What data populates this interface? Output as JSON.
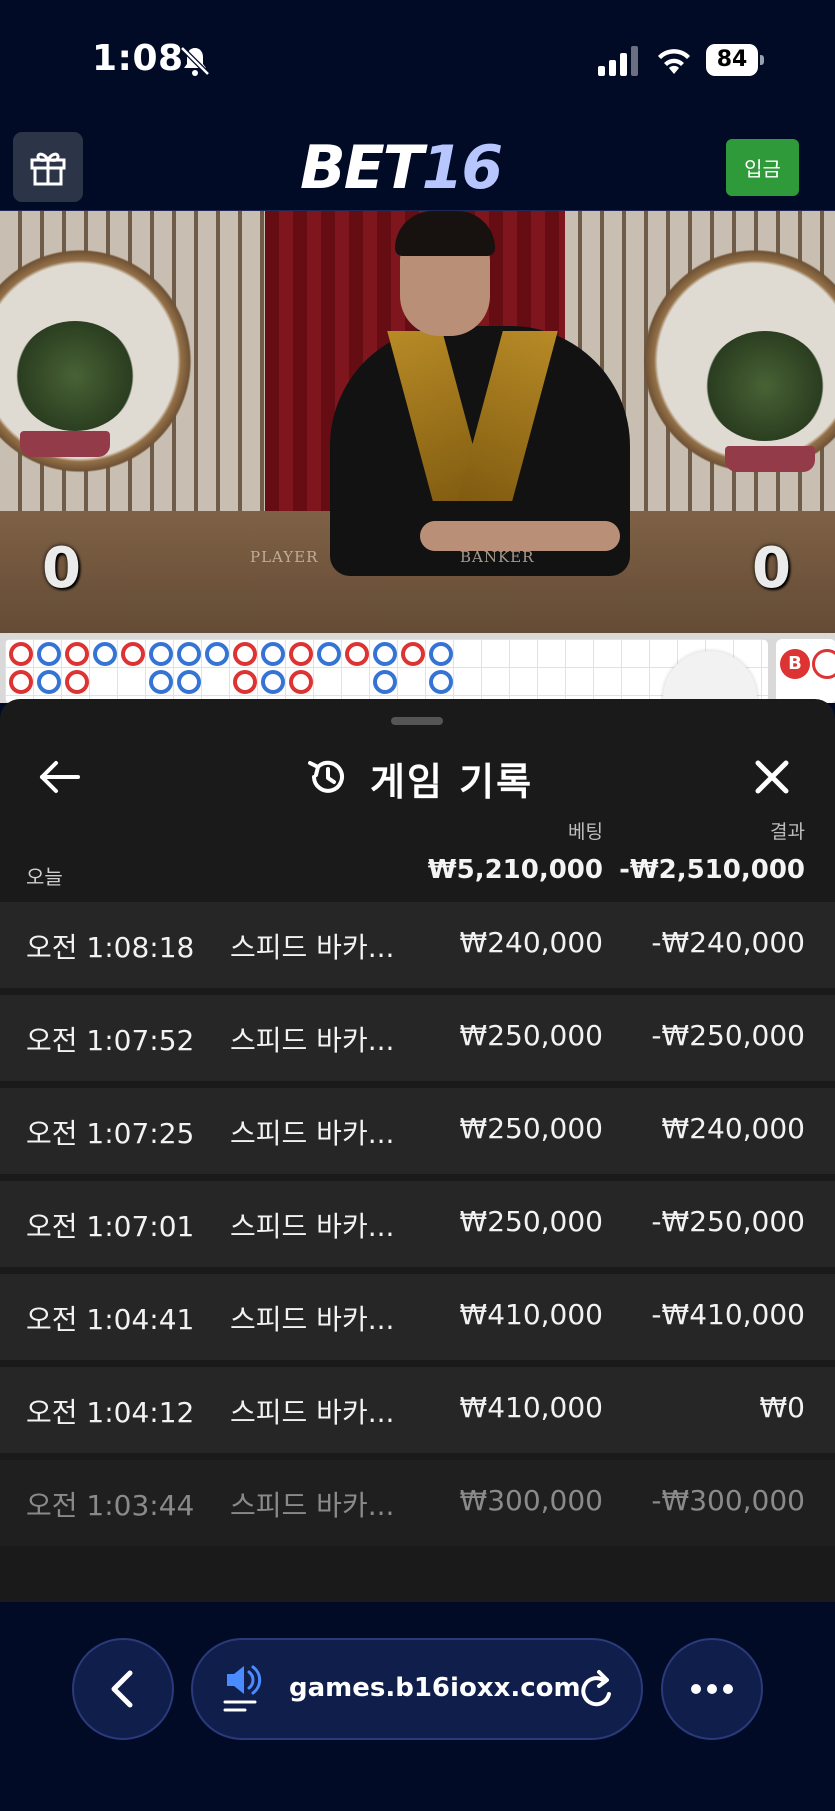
{
  "status_bar": {
    "time": "1:08",
    "battery": "84",
    "icons": [
      "bell-slash-icon",
      "signal-icon",
      "wifi-icon",
      "battery-icon"
    ]
  },
  "app_header": {
    "logo_part1": "BET",
    "logo_part2": "16",
    "deposit_label": "입금",
    "icons": [
      "gift-icon"
    ],
    "colors": {
      "deposit": "#2f9a3a",
      "logo_accent": "#b8c6ff"
    }
  },
  "video": {
    "player_score": "0",
    "banker_score": "0",
    "table_label_player": "PLAYER",
    "table_label_banker": "BANKER"
  },
  "road": {
    "side_badge": "B",
    "colors": {
      "banker": "#d33333",
      "player": "#3574d4"
    }
  },
  "history": {
    "title": "게임 기록",
    "col_bet": "베팅",
    "col_result": "결과",
    "today_label": "오늘",
    "total_bet": "₩5,210,000",
    "total_result": "-₩2,510,000",
    "rows": [
      {
        "time": "오전 1:08:18",
        "game": "스피드 바카...",
        "bet": "₩240,000",
        "result": "-₩240,000"
      },
      {
        "time": "오전 1:07:52",
        "game": "스피드 바카...",
        "bet": "₩250,000",
        "result": "-₩250,000"
      },
      {
        "time": "오전 1:07:25",
        "game": "스피드 바카...",
        "bet": "₩250,000",
        "result": "₩240,000"
      },
      {
        "time": "오전 1:07:01",
        "game": "스피드 바카...",
        "bet": "₩250,000",
        "result": "-₩250,000"
      },
      {
        "time": "오전 1:04:41",
        "game": "스피드 바카...",
        "bet": "₩410,000",
        "result": "-₩410,000"
      },
      {
        "time": "오전 1:04:12",
        "game": "스피드 바카...",
        "bet": "₩410,000",
        "result": "₩0"
      },
      {
        "time": "오전 1:03:44",
        "game": "스피드 바카...",
        "bet": "₩300,000",
        "result": "-₩300,000"
      }
    ],
    "icons": [
      "back-arrow-icon",
      "history-icon",
      "close-icon"
    ]
  },
  "browser": {
    "url": "games.b16ioxx.com",
    "icons": [
      "chevron-left-icon",
      "speaker-icon",
      "reload-icon",
      "more-icon"
    ]
  }
}
